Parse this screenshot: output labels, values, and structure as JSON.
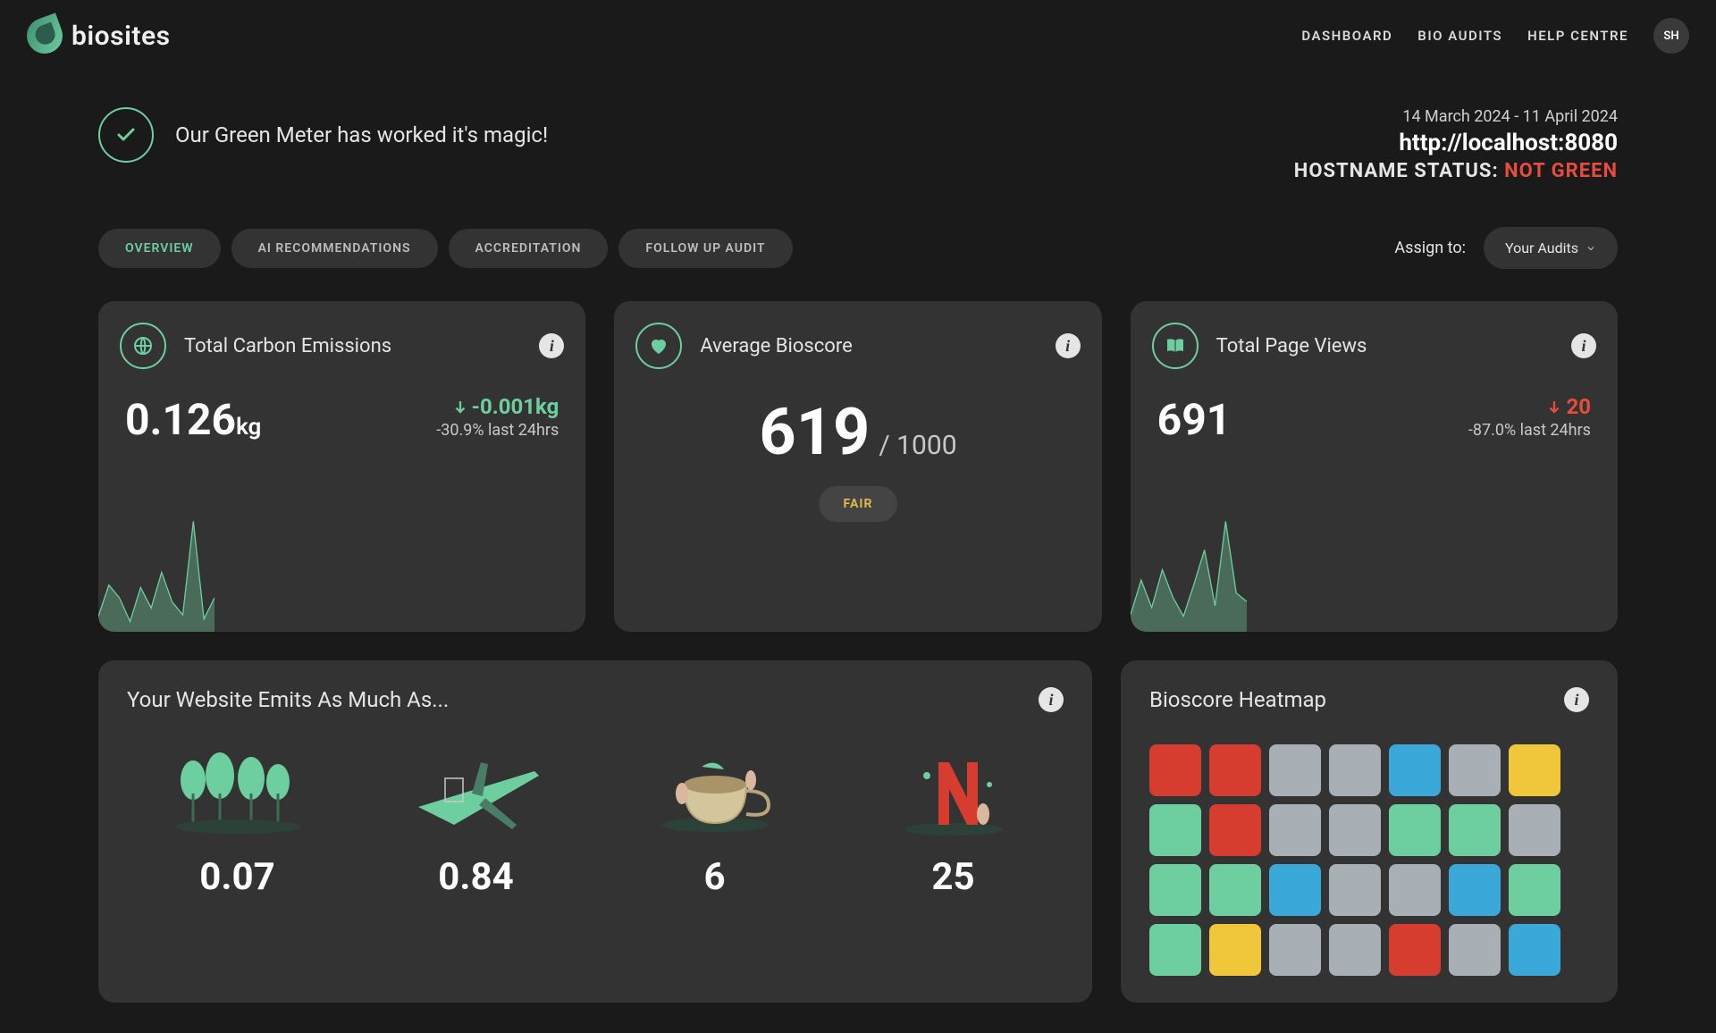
{
  "brand": {
    "name": "biosites"
  },
  "nav": {
    "dashboard": "DASHBOARD",
    "bio_audits": "BIO AUDITS",
    "help_centre": "HELP CENTRE",
    "avatar_initials": "SH"
  },
  "banner": {
    "text": "Our Green Meter has worked it's magic!"
  },
  "meta": {
    "date_range": "14 March 2024 - 11 April 2024",
    "host_url": "http://localhost:8080",
    "hostname_status_label": "HOSTNAME STATUS:",
    "hostname_status_value": "NOT GREEN"
  },
  "tabs": {
    "overview": "OVERVIEW",
    "ai_recommendations": "AI RECOMMENDATIONS",
    "accreditation": "ACCREDITATION",
    "follow_up_audit": "FOLLOW UP AUDIT"
  },
  "assign": {
    "label": "Assign to:",
    "value": "Your Audits"
  },
  "cards": {
    "emissions": {
      "title": "Total Carbon Emissions",
      "value": "0.126",
      "unit": "kg",
      "change_value": "-0.001kg",
      "change_percent": "-30.9% last 24hrs",
      "direction": "down",
      "spark": [
        18,
        55,
        40,
        12,
        52,
        28,
        70,
        35,
        20,
        130,
        15,
        40
      ]
    },
    "bioscore": {
      "title": "Average Bioscore",
      "score": "619",
      "max": "/ 1000",
      "badge": "FAIR"
    },
    "pageviews": {
      "title": "Total Page Views",
      "value": "691",
      "change_value": "20",
      "change_percent": "-87.0% last 24hrs",
      "direction": "down",
      "spark": [
        20,
        60,
        28,
        72,
        40,
        18,
        55,
        95,
        30,
        128,
        45,
        35
      ]
    }
  },
  "emits": {
    "title": "Your Website Emits As Much As...",
    "items": [
      {
        "value": "0.07",
        "icon": "trees"
      },
      {
        "value": "0.84",
        "icon": "plane"
      },
      {
        "value": "6",
        "icon": "tea"
      },
      {
        "value": "25",
        "icon": "netflix"
      }
    ]
  },
  "heatmap": {
    "title": "Bioscore Heatmap",
    "cells": [
      [
        "red",
        "red",
        "grey",
        "grey",
        "blue",
        "grey",
        "yellow"
      ],
      [
        "green",
        "red",
        "grey",
        "grey",
        "green",
        "green",
        "grey"
      ],
      [
        "green",
        "green",
        "blue",
        "grey",
        "grey",
        "blue",
        "green"
      ],
      [
        "green",
        "yellow",
        "grey",
        "grey",
        "red",
        "grey",
        "blue"
      ]
    ],
    "colors": {
      "red": "#d63d2f",
      "grey": "#a8b0b5",
      "blue": "#3aa8d8",
      "yellow": "#f0c63b",
      "green": "#6dcfa0"
    }
  },
  "chart_data": [
    {
      "type": "area",
      "title": "Total Carbon Emissions sparkline",
      "values": [
        18,
        55,
        40,
        12,
        52,
        28,
        70,
        35,
        20,
        130,
        15,
        40
      ]
    },
    {
      "type": "area",
      "title": "Total Page Views sparkline",
      "values": [
        20,
        60,
        28,
        72,
        40,
        18,
        55,
        95,
        30,
        128,
        45,
        35
      ]
    },
    {
      "type": "heatmap",
      "title": "Bioscore Heatmap",
      "rows": 4,
      "cols": 7,
      "cells": [
        [
          "red",
          "red",
          "grey",
          "grey",
          "blue",
          "grey",
          "yellow"
        ],
        [
          "green",
          "red",
          "grey",
          "grey",
          "green",
          "green",
          "grey"
        ],
        [
          "green",
          "green",
          "blue",
          "grey",
          "grey",
          "blue",
          "green"
        ],
        [
          "green",
          "yellow",
          "grey",
          "grey",
          "red",
          "grey",
          "blue"
        ]
      ]
    }
  ]
}
